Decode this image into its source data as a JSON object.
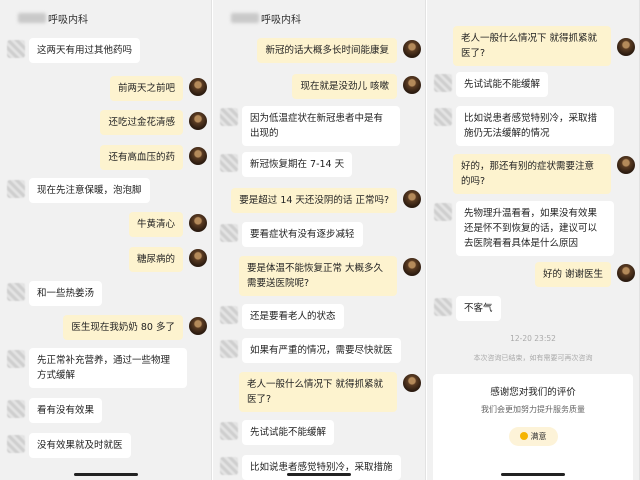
{
  "department": "呼吸内科",
  "panel1": {
    "messages": [
      {
        "side": "left",
        "text": "这两天有用过其他药吗"
      },
      {
        "side": "right",
        "text": "前两天之前吧"
      },
      {
        "side": "right",
        "text": "还吃过金花清感"
      },
      {
        "side": "right",
        "text": "还有高血压的药"
      },
      {
        "side": "left",
        "text": "现在先注意保暖，泡泡脚"
      },
      {
        "side": "right",
        "text": "牛黄清心"
      },
      {
        "side": "right",
        "text": "糖尿病的"
      },
      {
        "side": "left",
        "text": "和一些热姜汤"
      },
      {
        "side": "right",
        "text": "医生现在我奶奶 80 多了"
      },
      {
        "side": "left",
        "text": "先正常补充营养，通过一些物理方式缓解"
      },
      {
        "side": "left",
        "text": "看有没有效果"
      },
      {
        "side": "left",
        "text": "没有效果就及时就医"
      }
    ]
  },
  "panel2": {
    "messages": [
      {
        "side": "right",
        "text": "新冠的话大概多长时间能康复"
      },
      {
        "side": "right",
        "text": "现在就是没劲儿 咳嗽"
      },
      {
        "side": "left",
        "text": "因为低温症状在新冠患者中是有出现的"
      },
      {
        "side": "left",
        "text": "新冠恢复期在 7-14 天"
      },
      {
        "side": "right",
        "text": "要是超过 14 天还没阴的话 正常吗?"
      },
      {
        "side": "left",
        "text": "要看症状有没有逐步减轻"
      },
      {
        "side": "right",
        "text": "要是体温不能恢复正常 大概多久需要送医院呢?"
      },
      {
        "side": "left",
        "text": "还是要看老人的状态"
      },
      {
        "side": "left",
        "text": "如果有严重的情况，需要尽快就医"
      },
      {
        "side": "right",
        "text": "老人一般什么情况下 就得抓紧就医了?"
      },
      {
        "side": "left",
        "text": "先试试能不能缓解"
      },
      {
        "side": "left",
        "text": "比如说患者感觉特别冷，采取措施"
      }
    ]
  },
  "panel3": {
    "messages": [
      {
        "side": "right",
        "text": "老人一般什么情况下 就得抓紧就医了?"
      },
      {
        "side": "left",
        "text": "先试试能不能缓解"
      },
      {
        "side": "left",
        "text": "比如说患者感觉特别冷，采取措施仍无法缓解的情况"
      },
      {
        "side": "right",
        "text": "好的，那还有别的症状需要注意的吗?"
      },
      {
        "side": "left",
        "text": "先物理升温看看，如果没有效果还是怀不到恢复的话，建议可以去医院看看具体是什么原因"
      },
      {
        "side": "right",
        "text": "好的 谢谢医生"
      },
      {
        "side": "left",
        "text": "不客气"
      }
    ],
    "timestamp": "12-20 23:52",
    "notice": "本次咨询已结束，如有需要可再次咨询",
    "rating": {
      "title": "感谢您对我们的评价",
      "subtitle": "我们会更加努力提升服务质量",
      "button": "满意"
    }
  }
}
